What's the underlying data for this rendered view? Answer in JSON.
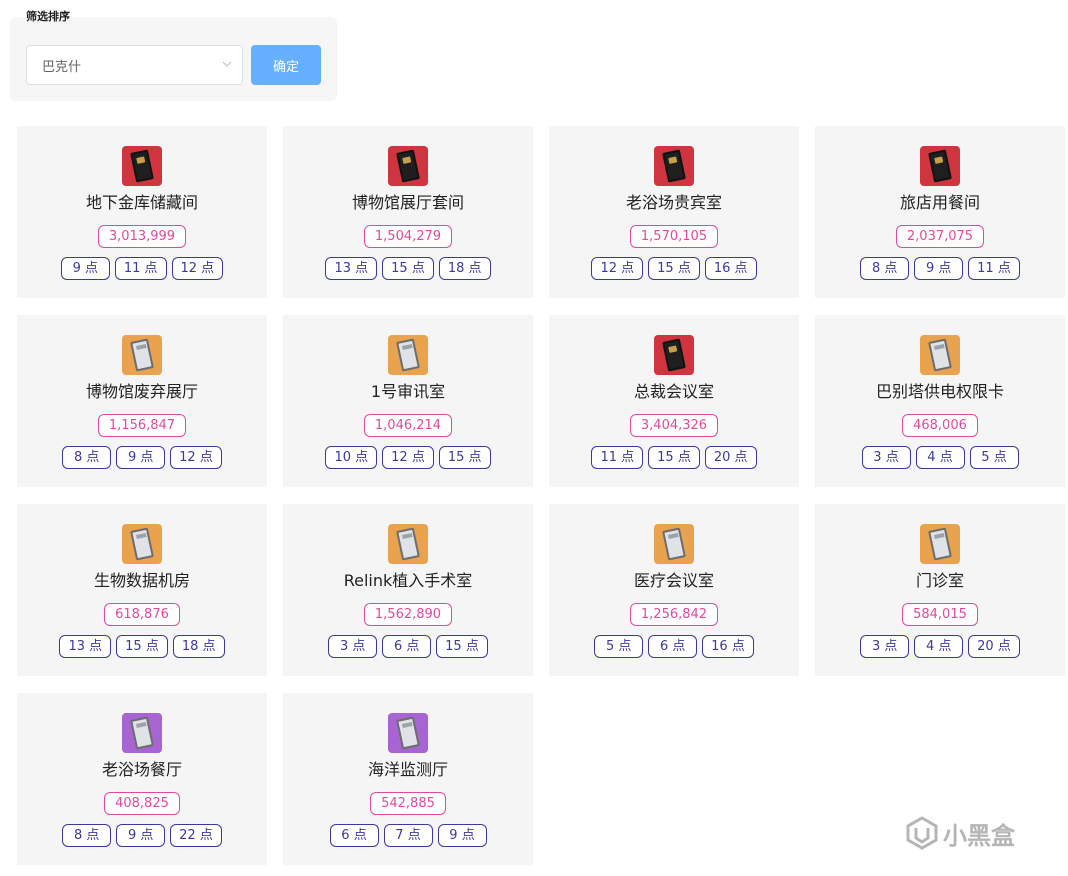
{
  "filter": {
    "title": "筛选排序",
    "select_value": "巴克什",
    "confirm_label": "确定"
  },
  "cards": [
    {
      "name": "地下金库储藏间",
      "price": "3,013,999",
      "icon": "red-keycard-icon",
      "points": [
        "9 点",
        "11 点",
        "12 点"
      ]
    },
    {
      "name": "博物馆展厅套间",
      "price": "1,504,279",
      "icon": "red-keycard-icon",
      "points": [
        "13 点",
        "15 点",
        "18 点"
      ]
    },
    {
      "name": "老浴场贵宾室",
      "price": "1,570,105",
      "icon": "red-keycard-icon",
      "points": [
        "12 点",
        "15 点",
        "16 点"
      ]
    },
    {
      "name": "旅店用餐间",
      "price": "2,037,075",
      "icon": "red-keycard-icon",
      "points": [
        "8 点",
        "9 点",
        "11 点"
      ]
    },
    {
      "name": "博物馆废弃展厅",
      "price": "1,156,847",
      "icon": "orange-keycard-icon",
      "points": [
        "8 点",
        "9 点",
        "12 点"
      ]
    },
    {
      "name": "1号审讯室",
      "price": "1,046,214",
      "icon": "orange-keycard-icon",
      "points": [
        "10 点",
        "12 点",
        "15 点"
      ]
    },
    {
      "name": "总裁会议室",
      "price": "3,404,326",
      "icon": "red-keycard-icon",
      "points": [
        "11 点",
        "15 点",
        "20 点"
      ]
    },
    {
      "name": "巴别塔供电权限卡",
      "price": "468,006",
      "icon": "orange-keycard-icon",
      "points": [
        "3 点",
        "4 点",
        "5 点"
      ]
    },
    {
      "name": "生物数据机房",
      "price": "618,876",
      "icon": "orange-keycard-icon",
      "points": [
        "13 点",
        "15 点",
        "18 点"
      ]
    },
    {
      "name": "Relink植入手术室",
      "price": "1,562,890",
      "icon": "orange-keycard-icon",
      "points": [
        "3 点",
        "6 点",
        "15 点"
      ]
    },
    {
      "name": "医疗会议室",
      "price": "1,256,842",
      "icon": "orange-keycard-icon",
      "points": [
        "5 点",
        "6 点",
        "16 点"
      ]
    },
    {
      "name": "门诊室",
      "price": "584,015",
      "icon": "orange-keycard-icon",
      "points": [
        "3 点",
        "4 点",
        "20 点"
      ]
    },
    {
      "name": "老浴场餐厅",
      "price": "408,825",
      "icon": "purple-keycard-icon",
      "points": [
        "8 点",
        "9 点",
        "22 点"
      ]
    },
    {
      "name": "海洋监测厅",
      "price": "542,885",
      "icon": "purple-keycard-icon",
      "points": [
        "6 点",
        "7 点",
        "9 点"
      ]
    }
  ],
  "watermark": {
    "text": "小黑盒"
  },
  "colors": {
    "price": "#e14a9c",
    "point": "#3a3a9c",
    "confirm": "#66b1ff",
    "icon_red": "#d0353f",
    "icon_orange": "#e9a24e",
    "icon_purple": "#a864d2"
  }
}
